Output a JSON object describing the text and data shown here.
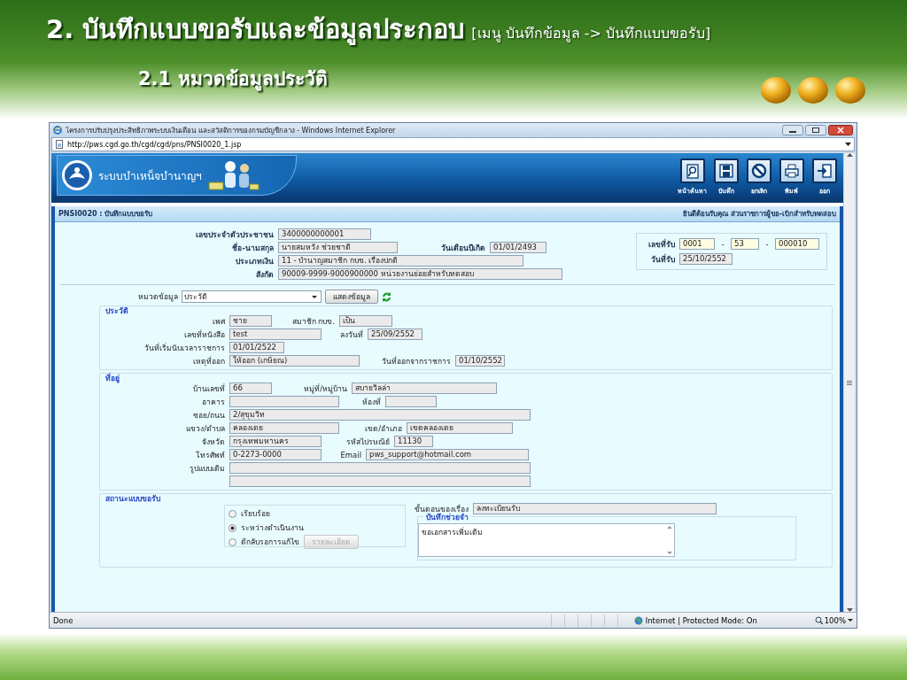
{
  "slide": {
    "title": "2. บันทึกแบบขอรับและข้อมูลประกอบ",
    "title_note": "[เมนู บันทึกข้อมูล -> บันทึกแบบขอรับ]",
    "subtitle": "2.1 หมวดข้อมูลประวัติ"
  },
  "window": {
    "title": "โครงการปรับปรุงประสิทธิภาพระบบเงินเดือน และสวัสดิการของกรมบัญชีกลาง - Windows Internet Explorer",
    "address": "http://pws.cgd.go.th/cgd/cgd/pns/PNSI0020_1.jsp"
  },
  "app": {
    "name": "ระบบบำเหน็จบำนาญฯ",
    "toolbar": [
      {
        "kind": "search",
        "label": "หน้าค้นหา"
      },
      {
        "kind": "save",
        "label": "บันทึก"
      },
      {
        "kind": "cancel",
        "label": "ยกเลิก"
      },
      {
        "kind": "print",
        "label": "พิมพ์"
      },
      {
        "kind": "exit",
        "label": "ออก"
      }
    ]
  },
  "page": {
    "code_title": "PNSI0020 : บันทึกแบบขอรับ",
    "welcome": "ยินดีต้อนรับคุณ ส่วนราชการผู้ขอ-เบิกสำหรับทดสอบ"
  },
  "header_fields": [
    [
      {
        "label": "เลขประจำตัวประชาชน",
        "value": "3400000000001"
      }
    ],
    [
      {
        "label": "ชื่อ-นามสกุล",
        "value": "นายสมหวัง ช่วยชาติ"
      },
      {
        "label": "วันเดือนปีเกิด",
        "value": "01/01/2493"
      }
    ],
    [
      {
        "label": "ประเภทเงิน",
        "value": "11 - บำนาญสมาชิก กบข.  เรื่องปกติ"
      }
    ],
    [
      {
        "label": "สังกัด",
        "value": "90009-9999-9000900000  หน่วยงานย่อยสำหรับทดสอบ"
      }
    ]
  ],
  "receipt": {
    "number_label": "เลขที่รับ",
    "number_parts": [
      {
        "value": "0001"
      },
      {
        "sep": "-",
        "value": "53"
      },
      {
        "sep": "-",
        "value": "000010"
      }
    ],
    "date_label": "วันที่รับ",
    "date": "25/10/2552"
  },
  "category": {
    "label": "หมวดข้อมูล",
    "value": "ประวัติ",
    "button": "แสดงข้อมูล"
  },
  "sections": [
    {
      "title": "ประวัติ",
      "rows": [
        [
          {
            "label": "เพศ",
            "value": "ชาย"
          },
          {
            "label": "สมาชิก กบข.",
            "value": "เป็น"
          }
        ],
        [
          {
            "label": "เลขที่หนังสือ",
            "value": "test"
          },
          {
            "label": "ลงวันที่",
            "value": "25/09/2552"
          }
        ],
        [
          {
            "label": "วันที่เริ่มนับเวลาราชการ",
            "value": "01/01/2522"
          }
        ],
        [
          {
            "label": "เหตุที่ออก",
            "value": "ให้ออก (เกษียณ)"
          },
          {
            "label": "วันที่ออกจากราชการ",
            "value": "01/10/2552"
          }
        ]
      ]
    },
    {
      "title": "ที่อยู่",
      "rows": [
        [
          {
            "label": "บ้านเลขที่",
            "value": "66"
          },
          {
            "label": "หมู่ที่/หมู่บ้าน",
            "value": "สบายวิลล่า"
          }
        ],
        [
          {
            "label": "อาคาร"
          },
          {
            "label": "ห้องที่"
          }
        ],
        [
          {
            "label": "ซอย/ถนน",
            "value": "2/สุขุมวิท"
          }
        ],
        [
          {
            "label": "แขวง/ตำบล",
            "value": "คลองเตย"
          },
          {
            "label": "เขต/อำเภอ",
            "value": "เขตคลองเตย"
          }
        ],
        [
          {
            "label": "จังหวัด",
            "value": "กรุงเทพมหานคร"
          },
          {
            "label": "รหัสไปรษณีย์",
            "value": "11130"
          }
        ],
        [
          {
            "label": "โทรศัพท์",
            "value": "0-2273-0000"
          },
          {
            "label": "Email",
            "value": "pws_support@hotmail.com"
          }
        ],
        [
          {
            "label": "รูปแบบเดิม"
          }
        ],
        [
          {}
        ]
      ]
    }
  ],
  "status": {
    "title": "สถานะแบบขอรับ",
    "options": [
      {
        "label": "เรียบร้อย",
        "selected": false
      },
      {
        "label": "ระหว่างดำเนินงาน",
        "selected": true
      },
      {
        "label": "ตีกลับรอการแก้ไข",
        "selected": false
      }
    ],
    "detail_button": {
      "label": "รายละเอียด",
      "disabled": true
    },
    "step_label": "ขั้นตอนของเรื่อง",
    "step": "ลงทะเบียนรับ",
    "memo_title": "บันทึกช่วยจำ",
    "memo": "ขอเอกสารเพิ่มเติม"
  },
  "status_bar": {
    "left": "Done",
    "zone": "Internet | Protected Mode: On",
    "zoom": "100%"
  }
}
